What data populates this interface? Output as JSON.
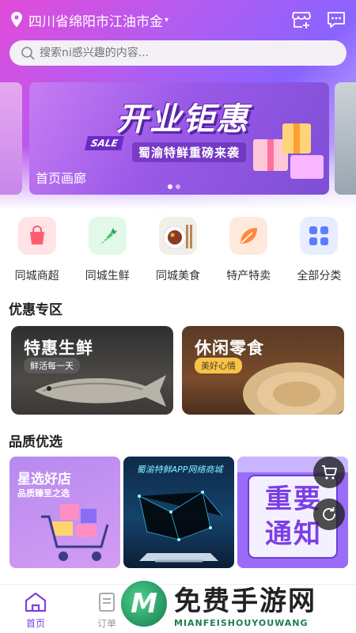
{
  "header": {
    "location": "四川省绵阳市江油市金",
    "caret": "▾"
  },
  "search": {
    "placeholder": "搜索ni感兴趣的内容..."
  },
  "banner": {
    "title": "开业钜惠",
    "subtitle": "蜀渝特鲜重磅来袭",
    "sale": "SALE",
    "caption": "首页画廊"
  },
  "categories": [
    {
      "label": "同城商超",
      "icon": "shopping-bag-icon",
      "color": "#ffe3e6"
    },
    {
      "label": "同城生鲜",
      "icon": "carrot-icon",
      "color": "#e2f8e8"
    },
    {
      "label": "同城美食",
      "icon": "food-plate-icon",
      "color": "#f2efe9"
    },
    {
      "label": "特产特卖",
      "icon": "leaf-icon",
      "color": "#ffe9dc"
    },
    {
      "label": "全部分类",
      "icon": "grid-icon",
      "color": "#e7ecff"
    }
  ],
  "promo": {
    "title": "优惠专区",
    "cards": [
      {
        "title": "特惠生鲜",
        "tag": "鲜活每一天"
      },
      {
        "title": "休闲零食",
        "tag": "美好心情"
      }
    ]
  },
  "quality": {
    "title": "品质优选",
    "cards": [
      {
        "title": "星选好店",
        "subtitle": "品质臻至之选"
      },
      {
        "title": "蜀渝特鲜APP网络商城"
      },
      {
        "title": "重要通知"
      }
    ]
  },
  "tabbar": {
    "home": "首页",
    "orders": "订单"
  },
  "watermark": {
    "cn": "免费手游网",
    "en": "MIANFEISHOUYOUWANG",
    "logo": "M"
  },
  "colors": {
    "accent": "#7b3fe4",
    "hero_start": "#e24bd9",
    "hero_end": "#8a63ff"
  }
}
